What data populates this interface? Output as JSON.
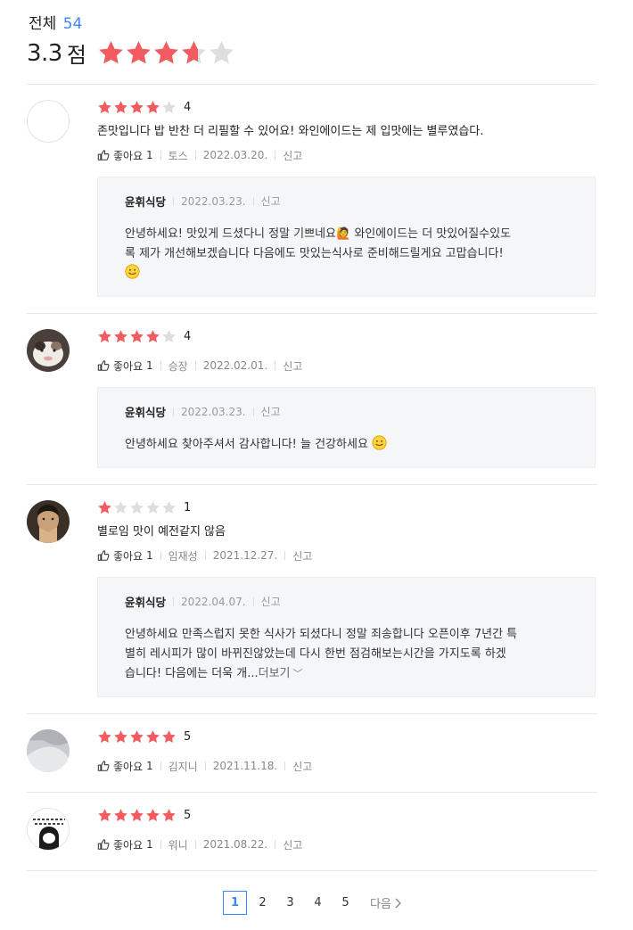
{
  "header": {
    "total_label": "전체",
    "total_count": "54",
    "score": "3.3",
    "score_unit": "점",
    "star_fill": 0.66
  },
  "colors": {
    "star_on": "#f25c61",
    "star_off": "#dedede",
    "accent": "#3a88ff"
  },
  "reviews": [
    {
      "rating": 4,
      "score": "4",
      "text": "존맛입니다 밥 반찬 더 리필할 수 있어요! 와인에이드는 제 입맛에는 별루였습다.",
      "like_label": "좋아요",
      "like_count": "1",
      "author": "토스",
      "date": "2022.03.20.",
      "report": "신고",
      "reply": {
        "owner": "윤휘식당",
        "date": "2022.03.23.",
        "report": "신고",
        "line1": "안녕하세요! 맛있게 드셨다니 정말 기쁘네요🙋 와인에이드는 더 맛있어질수있도",
        "line2": "록 제가 개선해보겠습니다 다음에도 맛있는식사로 준비해드릴게요  고맙습니다!"
      }
    },
    {
      "rating": 4,
      "score": "4",
      "like_label": "좋아요",
      "like_count": "1",
      "author": "승장",
      "date": "2022.02.01.",
      "report": "신고",
      "reply": {
        "owner": "윤휘식당",
        "date": "2022.03.23.",
        "report": "신고",
        "line1": "안녕하세요 찾아주셔서 감사합니다! 늘 건강하세요"
      }
    },
    {
      "rating": 1,
      "score": "1",
      "text": "별로임 맛이 예전같지 않음",
      "like_label": "좋아요",
      "like_count": "1",
      "author": "임재성",
      "date": "2021.12.27.",
      "report": "신고",
      "reply": {
        "owner": "윤휘식당",
        "date": "2022.04.07.",
        "report": "신고",
        "line1": "안녕하세요  만족스럽지 못한 식사가 되셨다니 정말 죄송합니다 오픈이후 7년간 특",
        "line2": "별히  레시피가 많이 바뀌진않았는데 다시 한번 점검해보는시간을 가지도록 하겠",
        "line3": "습니다! 다음에는 더욱 개...",
        "more": "더보기"
      }
    },
    {
      "rating": 5,
      "score": "5",
      "like_label": "좋아요",
      "like_count": "1",
      "author": "김지니",
      "date": "2021.11.18.",
      "report": "신고"
    },
    {
      "rating": 5,
      "score": "5",
      "like_label": "좋아요",
      "like_count": "1",
      "author": "워니",
      "date": "2021.08.22.",
      "report": "신고"
    }
  ],
  "pagination": {
    "pages": [
      "1",
      "2",
      "3",
      "4",
      "5"
    ],
    "current": "1",
    "next_label": "다음"
  }
}
